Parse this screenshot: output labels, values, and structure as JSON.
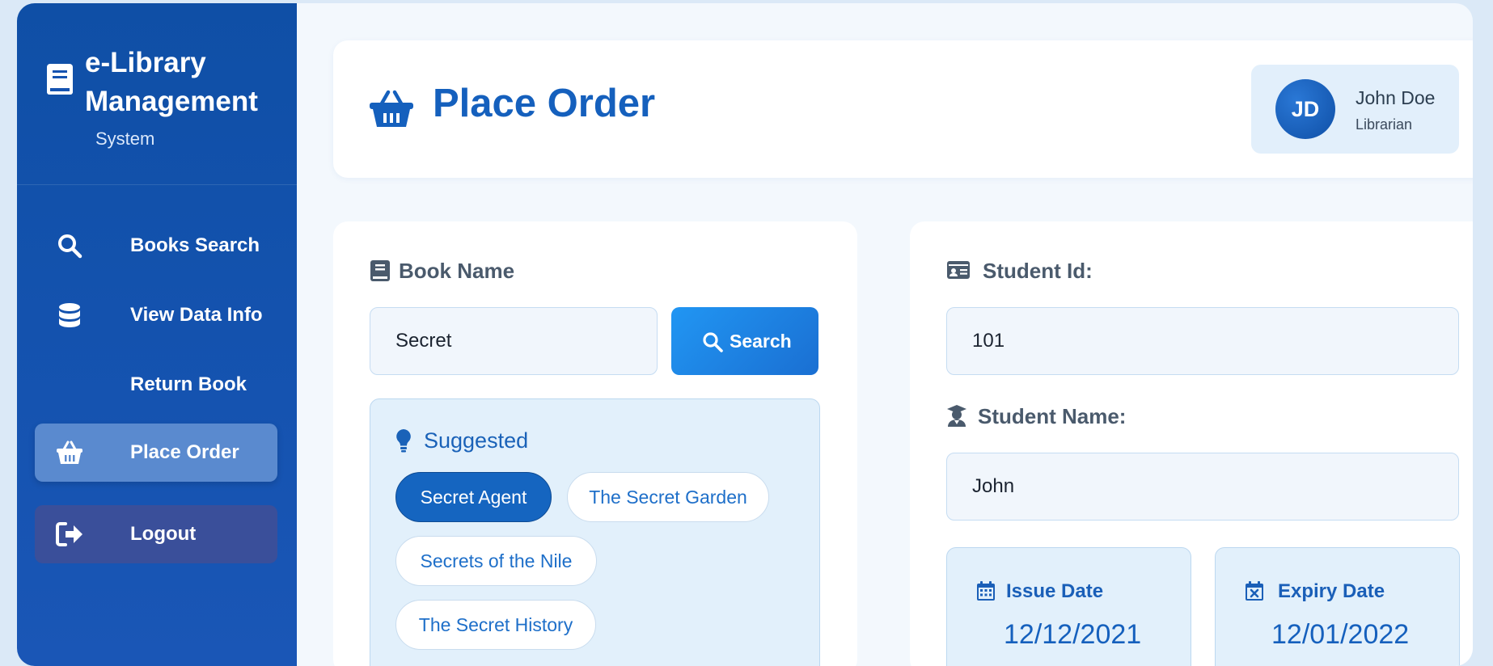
{
  "colors": {
    "sidebar_bg": "#1553b0",
    "accent": "#1560bd",
    "active_nav": "#5a8acf",
    "logout_bg": "#3a4f9a",
    "button": "#1e88e5"
  },
  "brand": {
    "title": "e-Library Management",
    "subtitle": "System",
    "icon": "book-icon"
  },
  "sidebar": {
    "items": [
      {
        "label": "Books Search",
        "icon": "search-icon"
      },
      {
        "label": "View Data Info",
        "icon": "database-icon"
      },
      {
        "label": "Return Book",
        "icon": ""
      },
      {
        "label": "Place Order",
        "icon": "basket-icon",
        "active": true
      },
      {
        "label": "Logout",
        "icon": "logout-icon"
      }
    ]
  },
  "header": {
    "title": "Place Order",
    "icon": "basket-icon"
  },
  "user": {
    "initials": "JD",
    "name": "John Doe",
    "role": "Librarian"
  },
  "book": {
    "label": "Book Name",
    "value": "Secret",
    "search_label": "Search",
    "suggested_label": "Suggested",
    "suggestions": [
      {
        "label": "Secret Agent",
        "selected": true
      },
      {
        "label": "The Secret Garden",
        "selected": false
      },
      {
        "label": "Secrets of the Nile",
        "selected": false
      },
      {
        "label": "The Secret History",
        "selected": false
      }
    ]
  },
  "student": {
    "id_label": "Student Id:",
    "id_value": "101",
    "name_label": "Student Name:",
    "name_value": "John"
  },
  "dates": {
    "issue_label": "Issue Date",
    "issue_value": "12/12/2021",
    "expiry_label": "Expiry Date",
    "expiry_value": "12/01/2022"
  }
}
